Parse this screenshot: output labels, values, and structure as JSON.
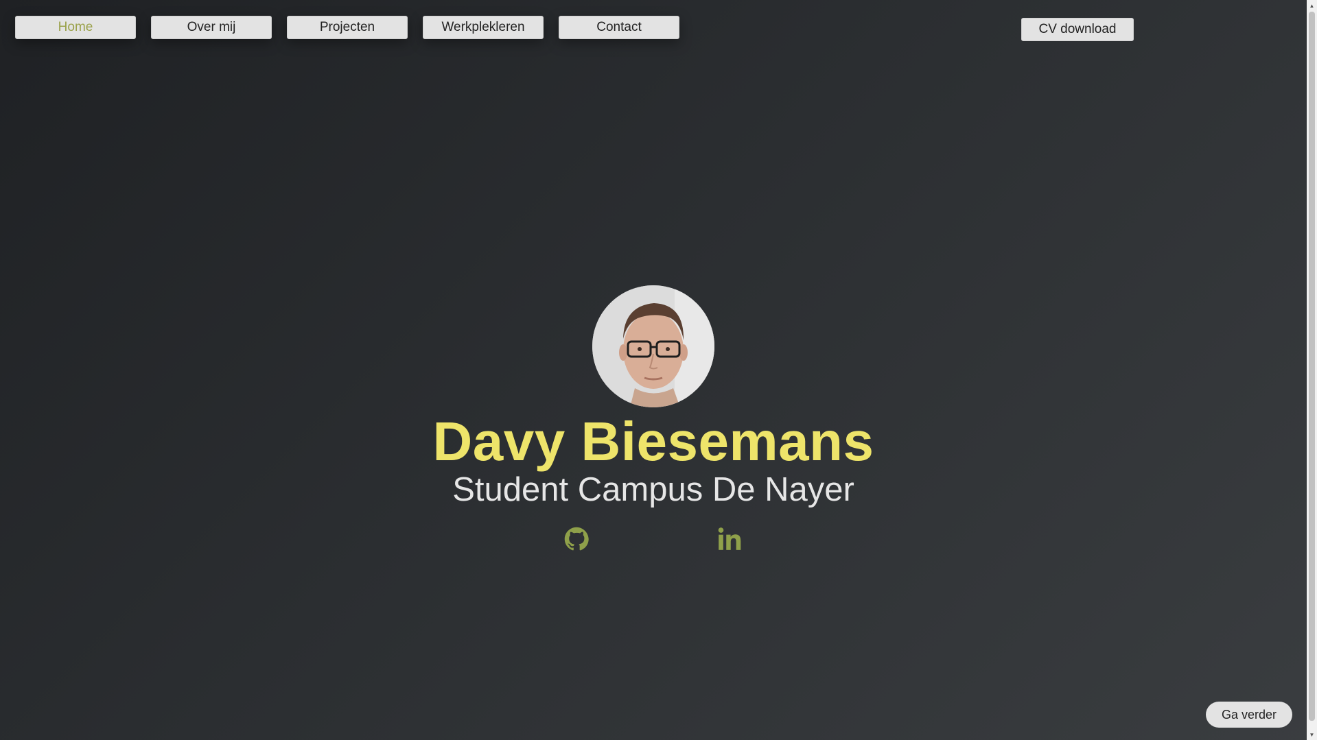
{
  "nav": {
    "items": [
      {
        "label": "Home",
        "active": true
      },
      {
        "label": "Over mij",
        "active": false
      },
      {
        "label": "Projecten",
        "active": false
      },
      {
        "label": "Werkplekleren",
        "active": false
      },
      {
        "label": "Contact",
        "active": false
      }
    ],
    "active_color": "#9aa14a"
  },
  "cv_button": {
    "label": "CV download"
  },
  "hero": {
    "name": "Davy Biesemans",
    "subtitle": "Student Campus De Nayer",
    "name_color": "#eee46a"
  },
  "socials": [
    {
      "icon": "github-icon"
    },
    {
      "icon": "linkedin-icon"
    }
  ],
  "social_color": "#8fa04a",
  "next_button": {
    "label": "Ga verder"
  }
}
